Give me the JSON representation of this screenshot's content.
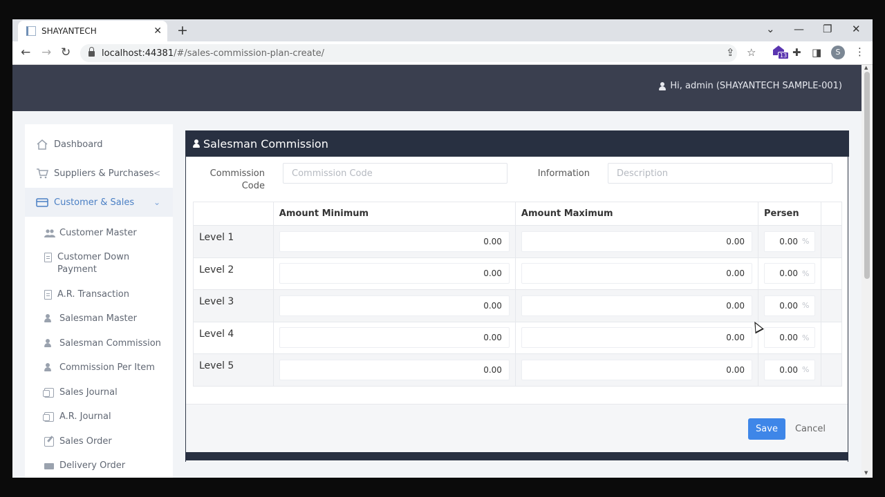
{
  "browser": {
    "tab_title": "SHAYANTECH",
    "tab_close": "✕",
    "new_tab": "+",
    "url_host": "localhost:44381",
    "url_path": "/#/sales-commission-plan-create/",
    "extension_badge": "13",
    "profile_initial": "S",
    "window_controls": {
      "dropdown": "⌄",
      "minimize": "—",
      "restore": "❐",
      "close": "✕"
    }
  },
  "header": {
    "user_greeting": "Hi, admin (SHAYANTECH SAMPLE-001)"
  },
  "sidebar": {
    "items": [
      {
        "label": "Dashboard",
        "icon": "home-icon"
      },
      {
        "label": "Suppliers & Purchases",
        "icon": "cart-icon",
        "chevron": "<"
      },
      {
        "label": "Customer & Sales",
        "icon": "credit-card-icon",
        "chevron": "⌄",
        "active": true
      }
    ],
    "subitems": [
      {
        "label": "Customer Master",
        "icon": "users-icon"
      },
      {
        "label": "Customer Down Payment",
        "icon": "document-icon"
      },
      {
        "label": "A.R. Transaction",
        "icon": "document-icon"
      },
      {
        "label": "Salesman Master",
        "icon": "person-icon"
      },
      {
        "label": "Salesman Commission",
        "icon": "person-icon"
      },
      {
        "label": "Commission Per Item",
        "icon": "person-icon"
      },
      {
        "label": "Sales Journal",
        "icon": "journal-icon"
      },
      {
        "label": "A.R. Journal",
        "icon": "journal-icon"
      },
      {
        "label": "Sales Order",
        "icon": "edit-icon"
      },
      {
        "label": "Delivery Order",
        "icon": "truck-icon"
      }
    ],
    "colors": {
      "active_text": "#4a7fc4",
      "active_bg": "#eef1f6"
    }
  },
  "card": {
    "title": "Salesman Commission",
    "commission_code_label_line1": "Commission",
    "commission_code_label_line2": "Code",
    "commission_code_placeholder": "Commission Code",
    "information_label": "Information",
    "information_placeholder": "Description",
    "table": {
      "headers": [
        "",
        "Amount Minimum",
        "Amount Maximum",
        "Persen",
        ""
      ],
      "percent_suffix": "%",
      "rows": [
        {
          "level": "Level 1",
          "min": "0.00",
          "max": "0.00",
          "persen": "0.00"
        },
        {
          "level": "Level 2",
          "min": "0.00",
          "max": "0.00",
          "persen": "0.00"
        },
        {
          "level": "Level 3",
          "min": "0.00",
          "max": "0.00",
          "persen": "0.00"
        },
        {
          "level": "Level 4",
          "min": "0.00",
          "max": "0.00",
          "persen": "0.00"
        },
        {
          "level": "Level 5",
          "min": "0.00",
          "max": "0.00",
          "persen": "0.00"
        }
      ]
    },
    "save_label": "Save",
    "cancel_label": "Cancel",
    "colors": {
      "header_bg": "#283041",
      "save_bg": "#3e86e8"
    }
  }
}
